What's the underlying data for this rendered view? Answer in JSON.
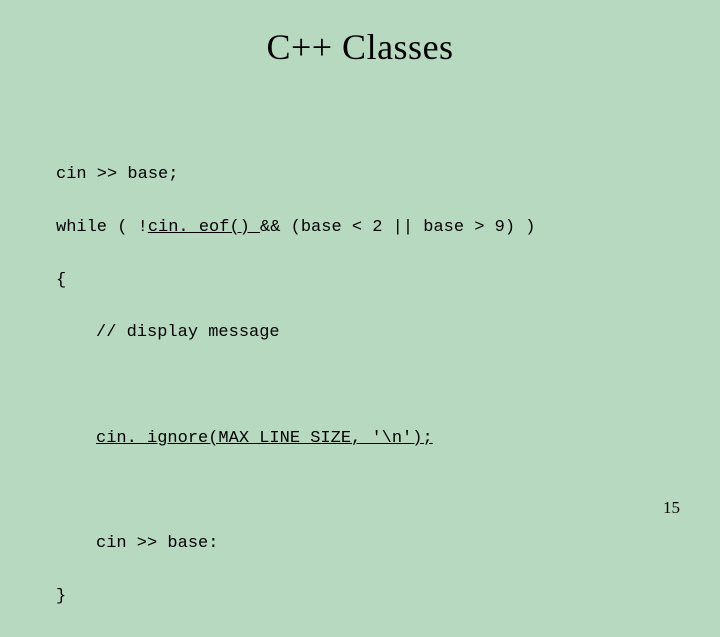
{
  "title": "C++ Classes",
  "code": {
    "l1": "cin >> base;",
    "l2a": "while ( !",
    "l2b": "cin. eof() ",
    "l2c": "&& (base < 2 || base > 9) )",
    "l3": "{",
    "l4": "// display message",
    "l6": "cin. ignore(MAX_LINE_SIZE, '\\n');",
    "l8": "cin >> base:",
    "l9": "}"
  },
  "page_number": "15"
}
